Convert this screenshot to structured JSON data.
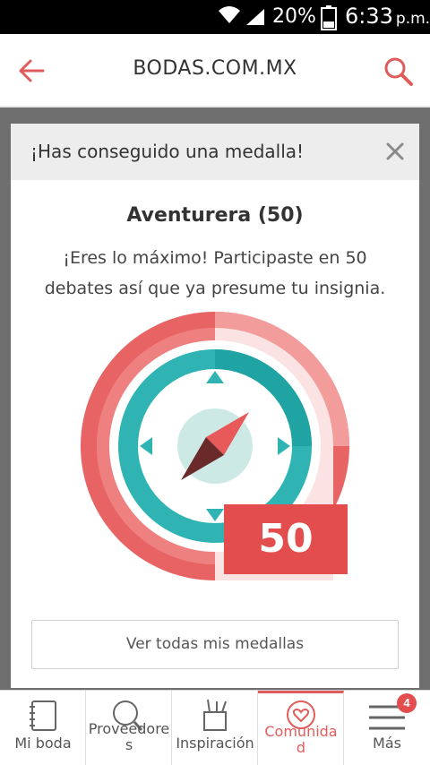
{
  "status_bar": {
    "battery_percent": "20%",
    "time": "6:33",
    "ampm": "p.m."
  },
  "header": {
    "title": "BODAS.COM.MX",
    "back_icon": "arrow-left-icon",
    "search_icon": "search-icon",
    "accent_color": "#e05b5b"
  },
  "modal": {
    "heading": "¡Has conseguido una medalla!",
    "medal_title": "Aventurera (50)",
    "description": "¡Eres lo máximo! Participaste en 50 debates así que ya presume tu insignia.",
    "badge_count": "50",
    "button_label": "Ver todas mis medallas",
    "colors": {
      "red": "#e34d4d",
      "teal": "#2fb3b3",
      "pink_light": "#fbe3e3"
    }
  },
  "bottom_nav": {
    "items": [
      {
        "label": "Mi boda",
        "icon": "notebook-icon"
      },
      {
        "label": "Proveedores",
        "label_line1": "Proveedore",
        "label_line2": "s",
        "icon": "search-icon"
      },
      {
        "label": "Inspiración",
        "icon": "pencil-cup-icon"
      },
      {
        "label": "Comunidad",
        "label_line1": "Comunida",
        "label_line2": "d",
        "icon": "heart-bubble-icon",
        "active": true
      },
      {
        "label": "Más",
        "icon": "menu-icon"
      }
    ],
    "more_badge": "4"
  }
}
